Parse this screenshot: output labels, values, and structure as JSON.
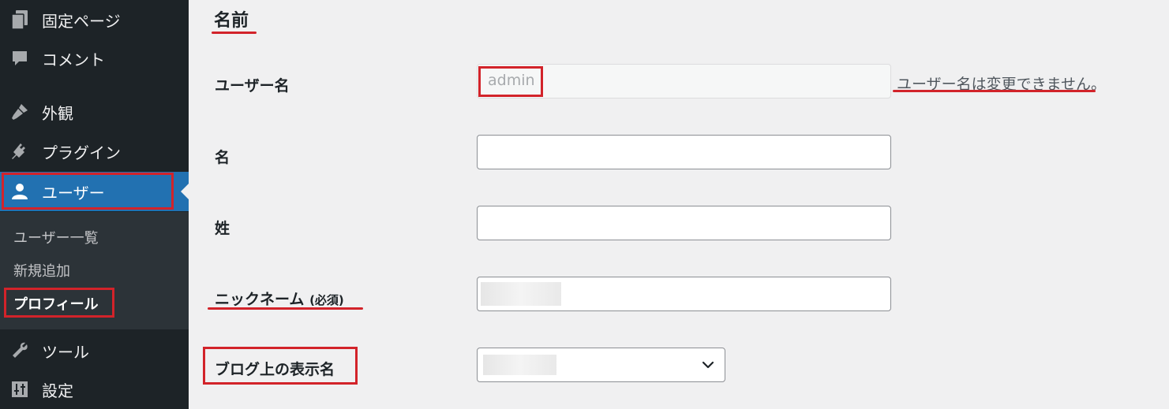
{
  "sidebar": {
    "items": [
      {
        "label": "固定ページ",
        "icon": "page-icon"
      },
      {
        "label": "コメント",
        "icon": "comment-icon"
      },
      {
        "label": "外観",
        "icon": "appearance-icon"
      },
      {
        "label": "プラグイン",
        "icon": "plugin-icon"
      },
      {
        "label": "ユーザー",
        "icon": "user-icon",
        "active": true
      },
      {
        "label": "ツール",
        "icon": "wrench-icon"
      },
      {
        "label": "設定",
        "icon": "settings-icon"
      }
    ],
    "submenu": [
      "ユーザー一覧",
      "新規追加",
      "プロフィール"
    ],
    "submenu_current": "プロフィール"
  },
  "section_title": "名前",
  "fields": {
    "username": {
      "label": "ユーザー名",
      "value": "admin",
      "hint": "ユーザー名は変更できません。"
    },
    "first_name": {
      "label": "名",
      "value": ""
    },
    "last_name": {
      "label": "姓",
      "value": ""
    },
    "nickname": {
      "label": "ニックネーム",
      "required": "(必須)"
    },
    "display_name": {
      "label": "ブログ上の表示名"
    }
  },
  "colors": {
    "sidebar_bg": "#1d2327",
    "active_bg": "#2271b1",
    "highlight": "#d2232a",
    "content_bg": "#f0f0f1"
  }
}
